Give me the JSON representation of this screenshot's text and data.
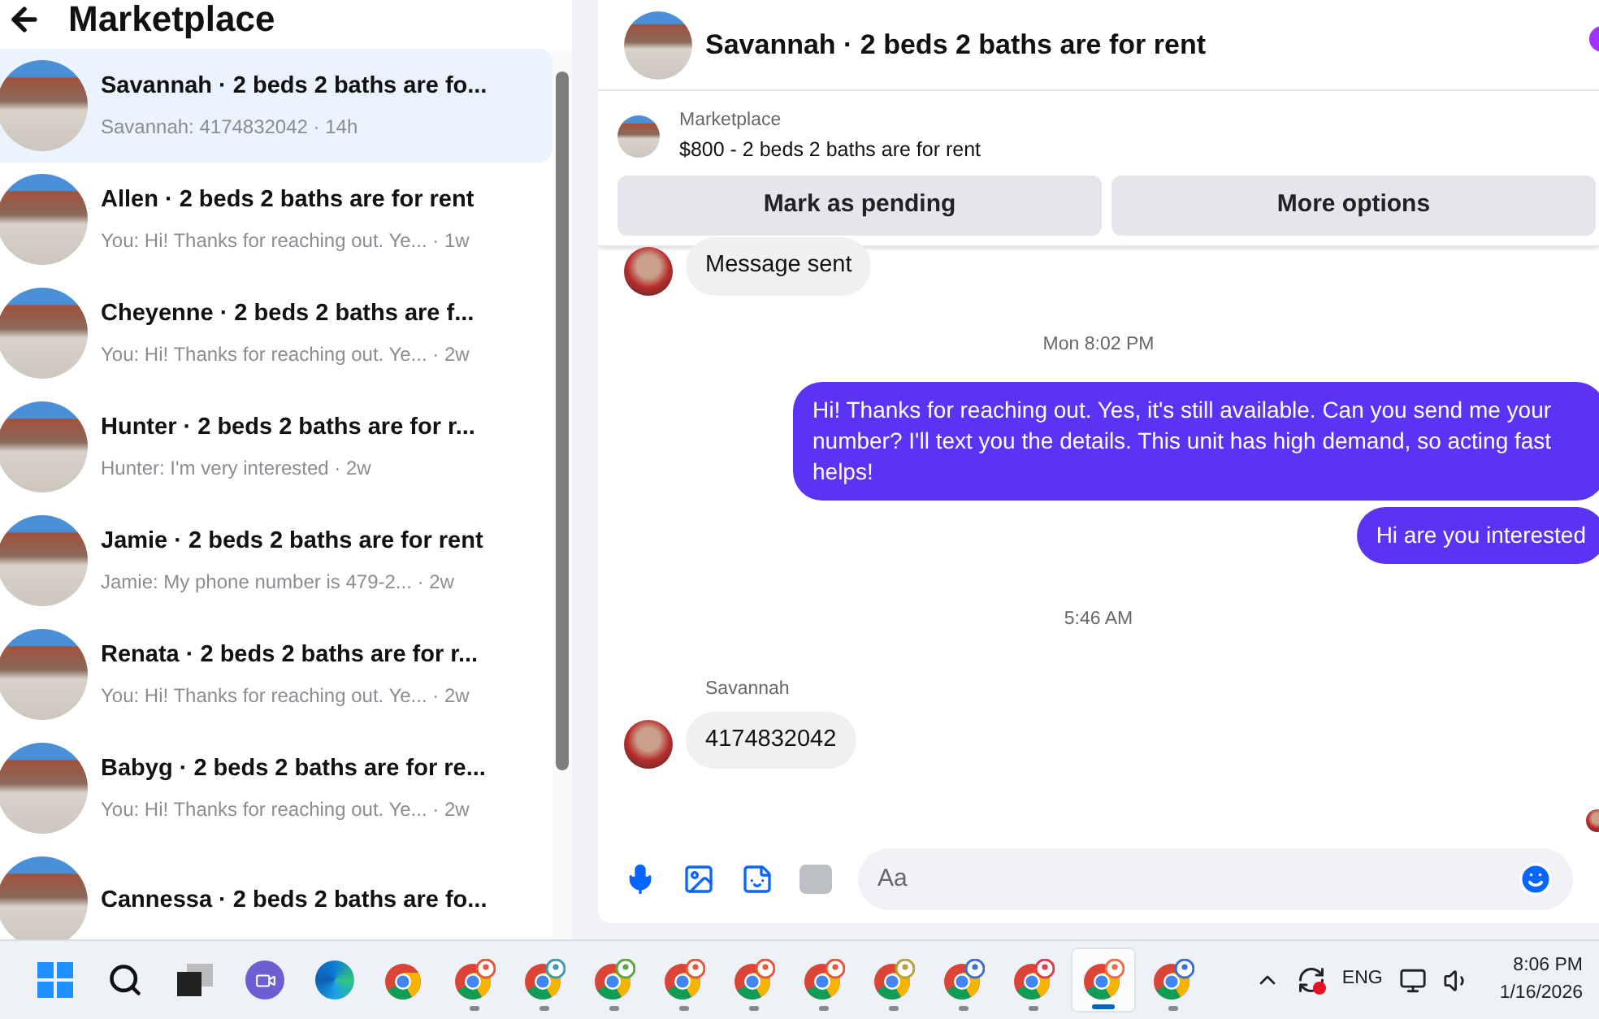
{
  "sidebar": {
    "title": "Marketplace",
    "conversations": [
      {
        "title": "Savannah · 2 beds 2 baths are fo...",
        "snippet": "Savannah: 4174832042 · 14h",
        "selected": true
      },
      {
        "title": "Allen · 2 beds 2 baths are for rent",
        "snippet": "You: Hi! Thanks for reaching out. Ye... · 1w",
        "selected": false
      },
      {
        "title": "Cheyenne · 2 beds 2 baths are f...",
        "snippet": "You: Hi! Thanks for reaching out. Ye... · 2w",
        "selected": false
      },
      {
        "title": "Hunter · 2 beds 2 baths are for r...",
        "snippet": "Hunter: I'm very interested · 2w",
        "selected": false
      },
      {
        "title": "Jamie · 2 beds 2 baths are for rent",
        "snippet": "Jamie: My phone number is 479-2...  · 2w",
        "selected": false
      },
      {
        "title": "Renata · 2 beds 2 baths are for r...",
        "snippet": "You: Hi! Thanks for reaching out. Ye... · 2w",
        "selected": false
      },
      {
        "title": "Babyg · 2 beds 2 baths are for re...",
        "snippet": "You: Hi! Thanks for reaching out. Ye... · 2w",
        "selected": false
      },
      {
        "title": "Cannessa · 2 beds 2 baths are fo...",
        "selected": false
      }
    ]
  },
  "chat": {
    "title": "Savannah · 2 beds 2 baths are for rent",
    "listing": {
      "source": "Marketplace",
      "summary": "$800 - 2 beds 2 baths are for rent"
    },
    "actions": [
      "Mark as pending",
      "More options"
    ],
    "messages": [
      {
        "kind": "incoming",
        "text": "Message sent"
      },
      {
        "kind": "timestamp",
        "text": "Mon 8:02 PM"
      },
      {
        "kind": "outgoing",
        "text": "Hi! Thanks for reaching out. Yes, it's still available. Can you send me your number? I'll text you the details. This unit has high demand, so acting fast helps!"
      },
      {
        "kind": "outgoing",
        "text": "Hi are you interested"
      },
      {
        "kind": "timestamp",
        "text": "5:46 AM"
      },
      {
        "kind": "incoming",
        "sender": "Savannah",
        "text": "4174832042"
      }
    ],
    "composer": {
      "placeholder": "Aa"
    }
  },
  "taskbar": {
    "apps": [
      {
        "kind": "start",
        "selected": false,
        "running": false
      },
      {
        "kind": "search",
        "selected": false,
        "running": false
      },
      {
        "kind": "taskview",
        "selected": false,
        "running": false
      },
      {
        "kind": "meet",
        "selected": false,
        "running": false
      },
      {
        "kind": "edge",
        "selected": false,
        "running": false
      },
      {
        "kind": "chrome",
        "selected": false,
        "running": false
      },
      {
        "kind": "profile",
        "color": "#e8553a",
        "selected": false,
        "running": true
      },
      {
        "kind": "profile",
        "color": "#3d9bb0",
        "selected": false,
        "running": true
      },
      {
        "kind": "profile",
        "color": "#5aa845",
        "selected": false,
        "running": true
      },
      {
        "kind": "profile",
        "color": "#e8553a",
        "selected": false,
        "running": true
      },
      {
        "kind": "profile",
        "color": "#e8553a",
        "selected": false,
        "running": true
      },
      {
        "kind": "profile",
        "color": "#e8553a",
        "selected": false,
        "running": true
      },
      {
        "kind": "profile",
        "color": "#b5a33a",
        "selected": false,
        "running": true
      },
      {
        "kind": "profile",
        "color": "#3b6fd8",
        "selected": false,
        "running": true
      },
      {
        "kind": "profile",
        "color": "#e23a4a",
        "selected": false,
        "running": true
      },
      {
        "kind": "profile",
        "color": "#f06a4a",
        "selected": true,
        "running": true
      },
      {
        "kind": "profile",
        "color": "#3b6fd8",
        "selected": false,
        "running": true
      }
    ],
    "language": "ENG",
    "time": "8:06 PM",
    "date": "1/16/2026"
  }
}
